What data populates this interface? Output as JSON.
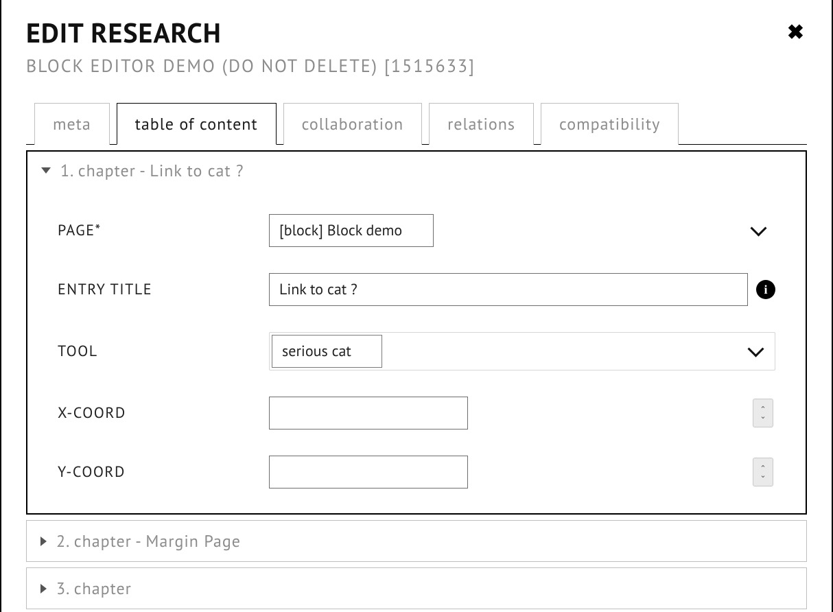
{
  "header": {
    "title": "EDIT RESEARCH",
    "subtitle": "BLOCK EDITOR DEMO (DO NOT DELETE) [1515633]"
  },
  "tabs": {
    "items": [
      {
        "label": "meta",
        "active": false
      },
      {
        "label": "table of content",
        "active": true
      },
      {
        "label": "collaboration",
        "active": false
      },
      {
        "label": "relations",
        "active": false
      },
      {
        "label": "compatibility",
        "active": false
      }
    ]
  },
  "chapters": [
    {
      "label": "1. chapter - Link to cat ?",
      "expanded": true
    },
    {
      "label": "2. chapter - Margin Page",
      "expanded": false
    },
    {
      "label": "3. chapter",
      "expanded": false
    }
  ],
  "form": {
    "page": {
      "label": "PAGE*",
      "value": "[block] Block demo"
    },
    "entry_title": {
      "label": "ENTRY TITLE",
      "value": "Link to cat ?"
    },
    "tool": {
      "label": "TOOL",
      "value": "serious cat"
    },
    "xcoord": {
      "label": "X-COORD",
      "value": ""
    },
    "ycoord": {
      "label": "Y-COORD",
      "value": ""
    }
  }
}
